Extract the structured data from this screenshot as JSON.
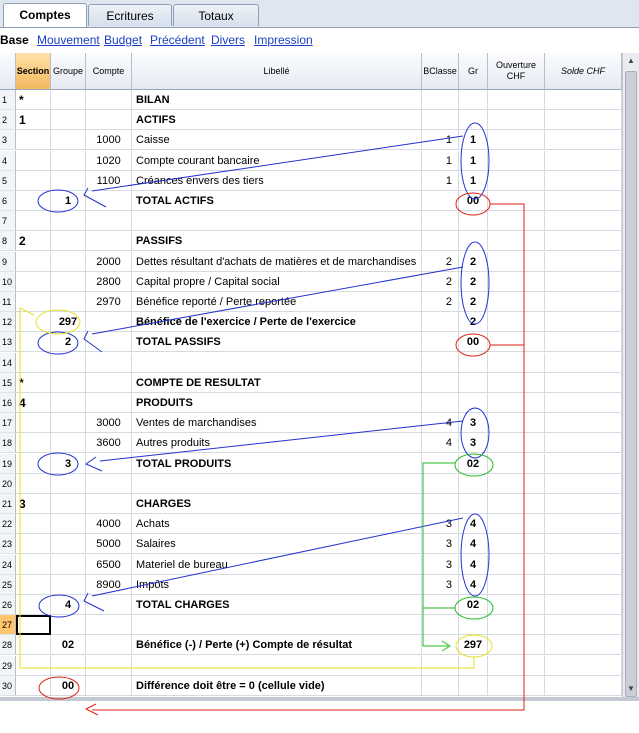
{
  "tabs": [
    {
      "label": "Comptes",
      "active": true
    },
    {
      "label": "Ecritures",
      "active": false
    },
    {
      "label": "Totaux",
      "active": false
    }
  ],
  "subnav": {
    "current": "Base",
    "links": [
      "Mouvement",
      "Budget",
      "Précédent",
      "Divers",
      "Impression"
    ]
  },
  "columns": [
    {
      "key": "section",
      "label": "Section"
    },
    {
      "key": "groupe",
      "label": "Groupe"
    },
    {
      "key": "compte",
      "label": "Compte"
    },
    {
      "key": "libelle",
      "label": "Libellé"
    },
    {
      "key": "bclasse",
      "label": "BClasse"
    },
    {
      "key": "gr",
      "label": "Gr"
    },
    {
      "key": "ouverture",
      "label": "Ouverture CHF"
    },
    {
      "key": "solde",
      "label": "Solde CHF"
    }
  ],
  "rows": [
    {
      "n": "1",
      "section": "*",
      "groupe": "",
      "compte": "",
      "libelle": "BILAN",
      "bold": true,
      "bclasse": "",
      "gr": ""
    },
    {
      "n": "2",
      "section": "1",
      "groupe": "",
      "compte": "",
      "libelle": "ACTIFS",
      "bold": true,
      "bclasse": "",
      "gr": ""
    },
    {
      "n": "3",
      "section": "",
      "groupe": "",
      "compte": "1000",
      "libelle": "Caisse",
      "bold": false,
      "bclasse": "1",
      "gr": "1"
    },
    {
      "n": "4",
      "section": "",
      "groupe": "",
      "compte": "1020",
      "libelle": "Compte courant bancaire",
      "bold": false,
      "bclasse": "1",
      "gr": "1"
    },
    {
      "n": "5",
      "section": "",
      "groupe": "",
      "compte": "1100",
      "libelle": "Créances envers des tiers",
      "bold": false,
      "bclasse": "1",
      "gr": "1"
    },
    {
      "n": "6",
      "section": "",
      "groupe": "1",
      "compte": "",
      "libelle": "TOTAL ACTIFS",
      "bold": true,
      "bclasse": "",
      "gr": "00"
    },
    {
      "n": "7",
      "section": "",
      "groupe": "",
      "compte": "",
      "libelle": "",
      "bold": false,
      "bclasse": "",
      "gr": ""
    },
    {
      "n": "8",
      "section": "2",
      "groupe": "",
      "compte": "",
      "libelle": "PASSIFS",
      "bold": true,
      "bclasse": "",
      "gr": ""
    },
    {
      "n": "9",
      "section": "",
      "groupe": "",
      "compte": "2000",
      "libelle": "Dettes résultant d'achats de matières et de marchandises",
      "bold": false,
      "bclasse": "2",
      "gr": "2"
    },
    {
      "n": "10",
      "section": "",
      "groupe": "",
      "compte": "2800",
      "libelle": "Capital propre / Capital social",
      "bold": false,
      "bclasse": "2",
      "gr": "2"
    },
    {
      "n": "11",
      "section": "",
      "groupe": "",
      "compte": "2970",
      "libelle": "Bénéfice reporté / Perte reportée",
      "bold": false,
      "bclasse": "2",
      "gr": "2"
    },
    {
      "n": "12",
      "section": "",
      "groupe": "297",
      "compte": "",
      "libelle": "Bénéfice de l'exercice / Perte de l'exercice",
      "bold": true,
      "bclasse": "",
      "gr": "2"
    },
    {
      "n": "13",
      "section": "",
      "groupe": "2",
      "compte": "",
      "libelle": "TOTAL PASSIFS",
      "bold": true,
      "bclasse": "",
      "gr": "00"
    },
    {
      "n": "14",
      "section": "",
      "groupe": "",
      "compte": "",
      "libelle": "",
      "bold": false,
      "bclasse": "",
      "gr": ""
    },
    {
      "n": "15",
      "section": "*",
      "groupe": "",
      "compte": "",
      "libelle": "COMPTE DE RESULTAT",
      "bold": true,
      "bclasse": "",
      "gr": ""
    },
    {
      "n": "16",
      "section": "4",
      "groupe": "",
      "compte": "",
      "libelle": "PRODUITS",
      "bold": true,
      "bclasse": "",
      "gr": ""
    },
    {
      "n": "17",
      "section": "",
      "groupe": "",
      "compte": "3000",
      "libelle": "Ventes de marchandises",
      "bold": false,
      "bclasse": "4",
      "gr": "3"
    },
    {
      "n": "18",
      "section": "",
      "groupe": "",
      "compte": "3600",
      "libelle": "Autres produits",
      "bold": false,
      "bclasse": "4",
      "gr": "3"
    },
    {
      "n": "19",
      "section": "",
      "groupe": "3",
      "compte": "",
      "libelle": "TOTAL PRODUITS",
      "bold": true,
      "bclasse": "",
      "gr": "02"
    },
    {
      "n": "20",
      "section": "",
      "groupe": "",
      "compte": "",
      "libelle": "",
      "bold": false,
      "bclasse": "",
      "gr": ""
    },
    {
      "n": "21",
      "section": "3",
      "groupe": "",
      "compte": "",
      "libelle": "CHARGES",
      "bold": true,
      "bclasse": "",
      "gr": ""
    },
    {
      "n": "22",
      "section": "",
      "groupe": "",
      "compte": "4000",
      "libelle": "Achats",
      "bold": false,
      "bclasse": "3",
      "gr": "4"
    },
    {
      "n": "23",
      "section": "",
      "groupe": "",
      "compte": "5000",
      "libelle": "Salaires",
      "bold": false,
      "bclasse": "3",
      "gr": "4"
    },
    {
      "n": "24",
      "section": "",
      "groupe": "",
      "compte": "6500",
      "libelle": "Materiel de bureau",
      "bold": false,
      "bclasse": "3",
      "gr": "4"
    },
    {
      "n": "25",
      "section": "",
      "groupe": "",
      "compte": "8900",
      "libelle": "Impôts",
      "bold": false,
      "bclasse": "3",
      "gr": "4"
    },
    {
      "n": "26",
      "section": "",
      "groupe": "4",
      "compte": "",
      "libelle": "TOTAL CHARGES",
      "bold": true,
      "bclasse": "",
      "gr": "02"
    },
    {
      "n": "27",
      "section": "",
      "groupe": "",
      "compte": "",
      "libelle": "",
      "bold": false,
      "bclasse": "",
      "gr": ""
    },
    {
      "n": "28",
      "section": "",
      "groupe": "02",
      "compte": "",
      "libelle": "Bénéfice (-) / Perte (+) Compte de résultat",
      "bold": true,
      "bclasse": "",
      "gr": "297"
    },
    {
      "n": "29",
      "section": "",
      "groupe": "",
      "compte": "",
      "libelle": "",
      "bold": false,
      "bclasse": "",
      "gr": ""
    },
    {
      "n": "30",
      "section": "",
      "groupe": "00",
      "compte": "",
      "libelle": "Différence doit être = 0 (cellule vide)",
      "bold": true,
      "bclasse": "",
      "gr": ""
    }
  ],
  "selected_row": "27",
  "colors": {
    "blue": "#2233cc",
    "red": "#dd2211",
    "green": "#22bb22",
    "yellow": "#e8e020"
  }
}
